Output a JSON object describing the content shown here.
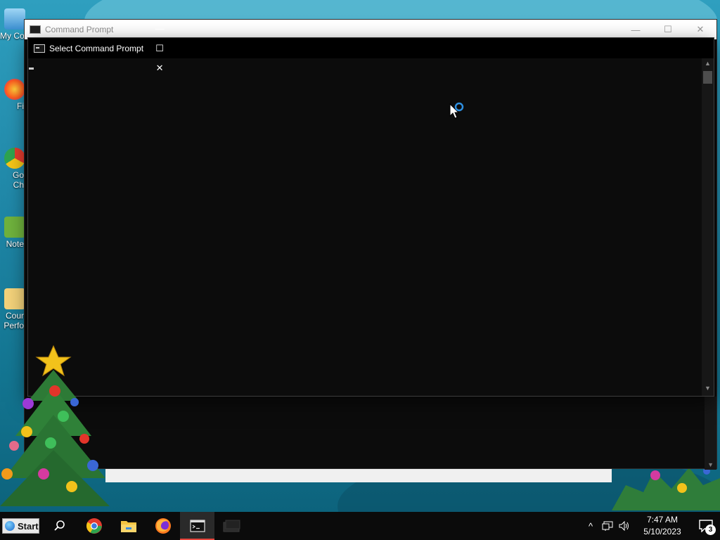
{
  "desktop": {
    "icons": [
      {
        "label": "My Co"
      },
      {
        "label": "Fi"
      },
      {
        "label": "Go\nCh"
      },
      {
        "label": "Note"
      },
      {
        "label": "Cour\nPerfo"
      }
    ]
  },
  "back_window": {
    "title": "Command Prompt",
    "minimize_glyph": "—",
    "maximize_glyph": "☐",
    "close_glyph": "✕"
  },
  "front_window": {
    "title": "Select Command Prompt",
    "minimize_glyph": "—",
    "maximize_glyph": "☐",
    "close_glyph": "✕",
    "scroll_up_glyph": "▲",
    "scroll_down_glyph": "▼"
  },
  "taskbar": {
    "start_label": "Start",
    "clock_time": "7:47 AM",
    "clock_date": "5/10/2023",
    "notification_count": "3",
    "tray_chevron": "^"
  },
  "colors": {
    "console_bg": "#0c0c0c",
    "taskbar_bg": "#0b0b0b",
    "active_indicator": "#e6453c"
  }
}
